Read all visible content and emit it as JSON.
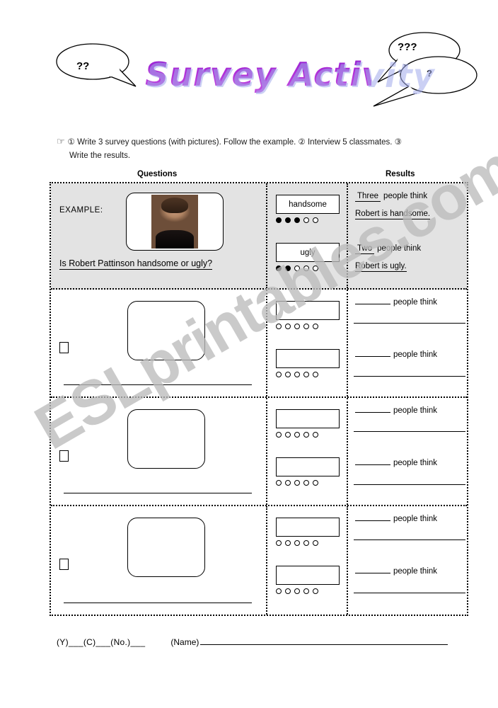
{
  "header": {
    "title": "Survey Activity",
    "bubble_left": "??",
    "bubble_right_top": "???",
    "bubble_right_bottom": "?",
    "title_color": "#9b1fc4"
  },
  "instructions": {
    "hand_icon": "pointing-hand-icon",
    "line1": "① Write 3 survey questions (with pictures).   Follow the example.  ② Interview 5 classmates. ③",
    "line2": "Write the results."
  },
  "columns": {
    "questions_caption": "Questions",
    "results_caption": "Results"
  },
  "table": {
    "example_row": {
      "label": "EXAMPLE:",
      "photo_alt": "robert-pattinson-photo",
      "question": "Is Robert Pattinson handsome or ugly?",
      "scales": [
        {
          "label": "handsome",
          "filled": 3,
          "total": 5
        },
        {
          "label": "ugly",
          "filled": 2,
          "total": 5
        }
      ],
      "results": [
        {
          "count": "Three",
          "think": "people think",
          "sentence": "Robert is handsome."
        },
        {
          "count": "Two",
          "think": "people think",
          "sentence": "Robert is ugly."
        }
      ]
    },
    "blank_rows": [
      {
        "checkbox": "",
        "question": "",
        "scales": [
          {
            "label": "",
            "filled": 0,
            "total": 5
          },
          {
            "label": "",
            "filled": 0,
            "total": 5
          }
        ],
        "results": [
          {
            "count": "",
            "think": "people think",
            "sentence": ""
          },
          {
            "count": "",
            "think": "people think",
            "sentence": ""
          }
        ]
      },
      {
        "checkbox": "",
        "question": "",
        "scales": [
          {
            "label": "",
            "filled": 0,
            "total": 5
          },
          {
            "label": "",
            "filled": 0,
            "total": 5
          }
        ],
        "results": [
          {
            "count": "",
            "think": "people think",
            "sentence": ""
          },
          {
            "count": "",
            "think": "people think",
            "sentence": ""
          }
        ]
      },
      {
        "checkbox": "",
        "question": "",
        "scales": [
          {
            "label": "",
            "filled": 0,
            "total": 5
          },
          {
            "label": "",
            "filled": 0,
            "total": 5
          }
        ],
        "results": [
          {
            "count": "",
            "think": "people think",
            "sentence": ""
          },
          {
            "count": "",
            "think": "people think",
            "sentence": ""
          }
        ]
      }
    ]
  },
  "footer": {
    "code_fields": "(Y)___(C)___(No.)___",
    "name_label": "(Name)"
  },
  "watermark": {
    "text": "ESLprintables.com",
    "color": "#bcbcbc"
  }
}
